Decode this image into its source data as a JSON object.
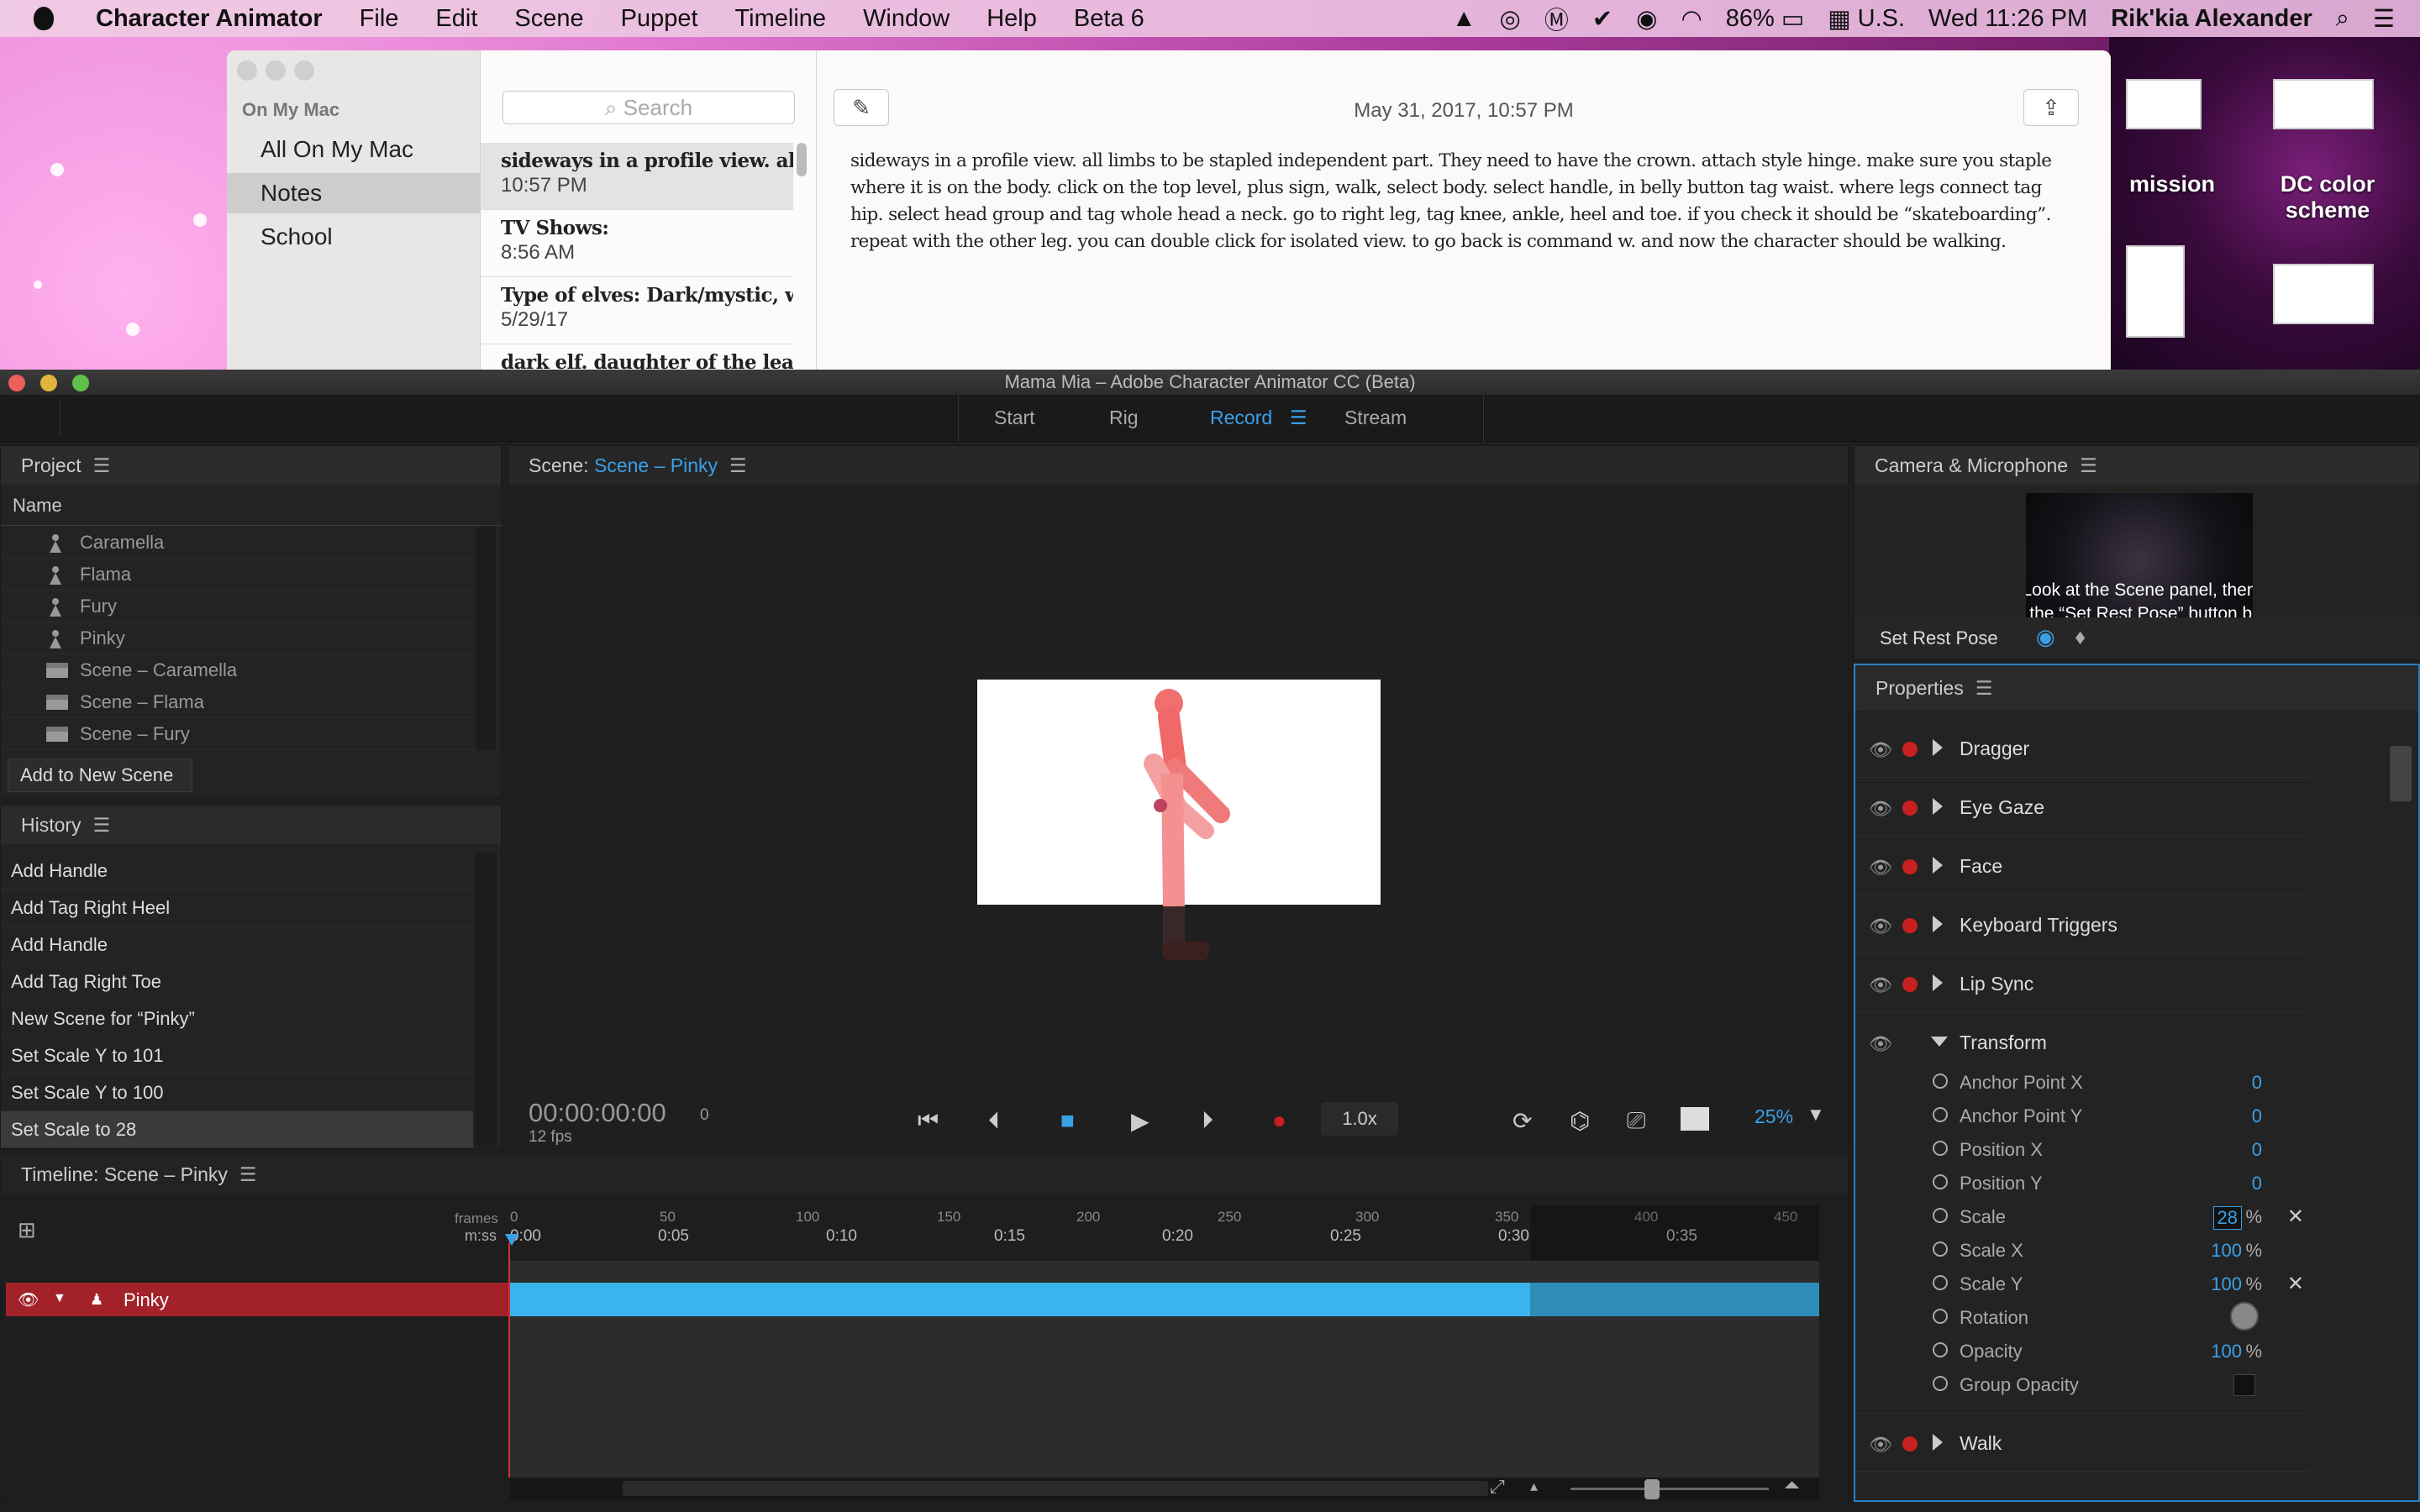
{
  "menubar": {
    "app": "Character Animator",
    "items": [
      "File",
      "Edit",
      "Scene",
      "Puppet",
      "Timeline",
      "Window",
      "Help",
      "Beta 6"
    ],
    "battery": "86%",
    "input_source": "U.S.",
    "datetime": "Wed 11:26 PM",
    "user": "Rik'kia Alexander"
  },
  "desktop": {
    "icons": [
      {
        "label": "mission"
      },
      {
        "label": "DC color scheme"
      }
    ]
  },
  "notes": {
    "group": "On My Mac",
    "folders": [
      "All On My Mac",
      "Notes",
      "School"
    ],
    "search_placeholder": "Search",
    "list": [
      {
        "title": "sideways in a profile view. all li...",
        "date": "10:57 PM"
      },
      {
        "title": "TV Shows:",
        "date": "8:56 AM"
      },
      {
        "title": "Type of elves: Dark/mystic, w...",
        "date": "5/29/17"
      },
      {
        "title": "dark elf. daughter of the leade...",
        "date": ""
      }
    ],
    "editor_date": "May 31, 2017, 10:57 PM",
    "body": "sideways in a profile view. all limbs to be stapled independent part. They need to have the crown. attach style hinge. make sure you staple where it is on the body.  click on the top level, plus sign, walk, select body. select handle, in belly button tag waist. where legs connect tag hip. select head group and tag whole head a neck. go to right leg, tag knee, ankle, heel and toe. if you check it should be “skateboarding”. repeat with the other leg. you can double click for isolated view. to go back is command w. and now the character should be walking."
  },
  "window": {
    "title": "Mama Mia – Adobe Character Animator CC (Beta)",
    "tabs": [
      "Start",
      "Rig",
      "Record",
      "Stream"
    ]
  },
  "project": {
    "title": "Project",
    "column": "Name",
    "items": [
      {
        "name": "Caramella",
        "kind": "puppet"
      },
      {
        "name": "Flama",
        "kind": "puppet"
      },
      {
        "name": "Fury",
        "kind": "puppet"
      },
      {
        "name": "Pinky",
        "kind": "puppet"
      },
      {
        "name": "Scene – Caramella",
        "kind": "scene"
      },
      {
        "name": "Scene – Flama",
        "kind": "scene"
      },
      {
        "name": "Scene – Fury",
        "kind": "scene"
      }
    ],
    "add_button": "Add to New Scene"
  },
  "history": {
    "title": "History",
    "items": [
      "Add Handle",
      "Add Tag Right Heel",
      "Add Handle",
      "Add Tag Right Toe",
      "New Scene for “Pinky”",
      "Set Scale Y to 101",
      "Set Scale Y to 100",
      "Set Scale to 28"
    ]
  },
  "scene": {
    "label": "Scene:",
    "name": "Scene – Pinky",
    "timecode": "00:00:00:00",
    "frame": "0",
    "fps": "12 fps",
    "speed": "1.0x",
    "zoom": "25%"
  },
  "camera": {
    "title": "Camera & Microphone",
    "message_line1": "Look at the Scene panel, then",
    "message_line2": "click the “Set Rest Pose” button below",
    "rest_pose": "Set Rest Pose"
  },
  "properties": {
    "title": "Properties",
    "behaviors": [
      "Dragger",
      "Eye Gaze",
      "Face",
      "Keyboard Triggers",
      "Lip Sync"
    ],
    "transform": "Transform",
    "params": [
      {
        "label": "Anchor Point X",
        "value": "0",
        "unit": ""
      },
      {
        "label": "Anchor Point Y",
        "value": "0",
        "unit": ""
      },
      {
        "label": "Position X",
        "value": "0",
        "unit": ""
      },
      {
        "label": "Position Y",
        "value": "0",
        "unit": ""
      },
      {
        "label": "Scale",
        "value": "28",
        "unit": "%"
      },
      {
        "label": "Scale X",
        "value": "100",
        "unit": "%"
      },
      {
        "label": "Scale Y",
        "value": "100",
        "unit": "%"
      },
      {
        "label": "Rotation",
        "value": "",
        "unit": ""
      },
      {
        "label": "Opacity",
        "value": "100",
        "unit": "%"
      },
      {
        "label": "Group Opacity",
        "value": "",
        "unit": ""
      }
    ],
    "walk": "Walk"
  },
  "timeline": {
    "title": "Timeline: Scene – Pinky",
    "frames_label": "frames",
    "mss_label": "m:ss",
    "frame_ticks": [
      "0",
      "50",
      "100",
      "150",
      "200",
      "250",
      "300",
      "350",
      "400",
      "450"
    ],
    "time_ticks": [
      "0:00",
      "0:05",
      "0:10",
      "0:15",
      "0:20",
      "0:25",
      "0:30",
      "0:35"
    ],
    "track": "Pinky"
  },
  "colors": {
    "accent": "#3aa0e8",
    "track": "#3ab4ec",
    "track_header": "#a3222a",
    "record": "#c82020"
  }
}
